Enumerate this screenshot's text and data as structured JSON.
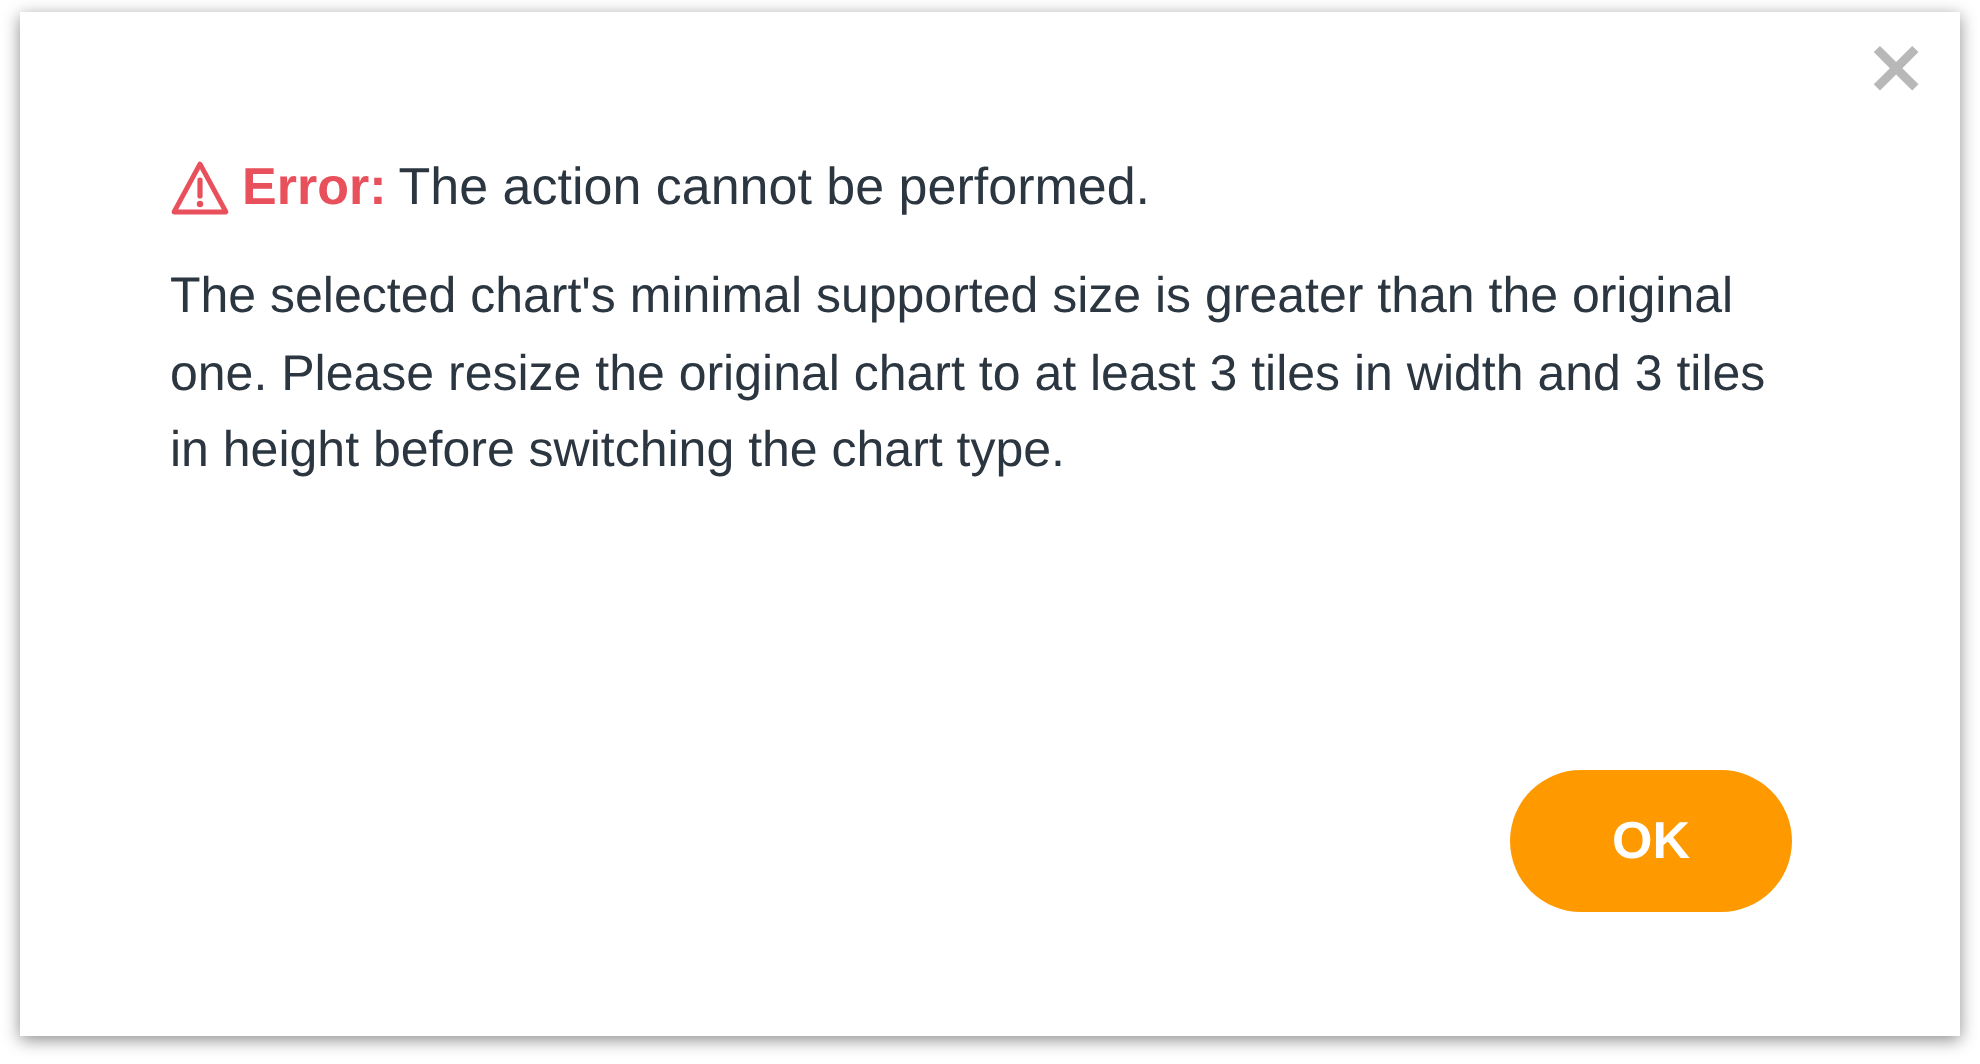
{
  "dialog": {
    "close": "×",
    "error_label": "Error:",
    "error_message": "The action cannot be performed.",
    "body": "The selected chart's minimal supported size is greater than the original one. Please resize the original chart to at least 3 tiles in width and 3 tiles in height before switching the chart type.",
    "buttons": [
      "OK"
    ]
  }
}
